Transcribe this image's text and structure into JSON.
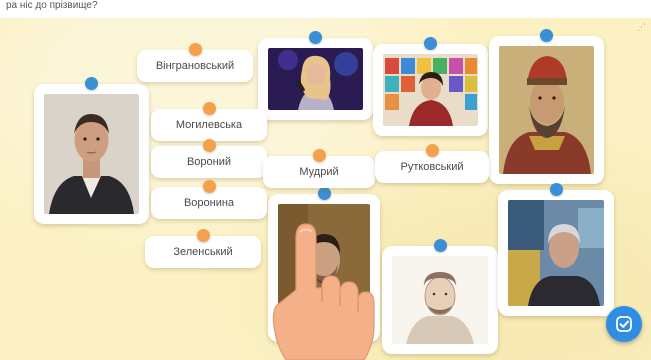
{
  "header": {
    "instruction": "ра ніс до прізвище?"
  },
  "labels": [
    "Вінграновський",
    "Могилевська",
    "Вороний",
    "Воронина",
    "Зеленський",
    "Мудрий",
    "Рутковський"
  ],
  "photos": [
    "man-portrait",
    "woman-singer",
    "woman-with-books",
    "medieval-prince",
    "president-portrait",
    "old-man-drawing",
    "elderly-man"
  ],
  "controls": {
    "check_icon": "check-icon"
  },
  "colors": {
    "board": "#fbf1c4",
    "dot_orange": "#f5a04a",
    "dot_blue": "#3b8fd6",
    "button": "#2f8de4"
  }
}
